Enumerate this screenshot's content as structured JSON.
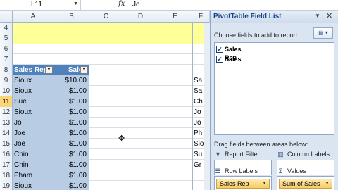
{
  "formula_bar": {
    "name_box": "L11",
    "fx": "fx",
    "value": "Jo"
  },
  "columns": [
    "A",
    "B",
    "C",
    "D",
    "E",
    "F"
  ],
  "rows": [
    {
      "num": "4",
      "type": "yellow",
      "a": "",
      "b": "",
      "f": ""
    },
    {
      "num": "5",
      "type": "yellow",
      "a": "",
      "b": "",
      "f": ""
    },
    {
      "num": "6",
      "type": "plain",
      "a": "",
      "b": "",
      "f": ""
    },
    {
      "num": "7",
      "type": "plain",
      "a": "",
      "b": "",
      "f": ""
    },
    {
      "num": "8",
      "type": "hdr",
      "a": "Sales Rep",
      "b": "Sales",
      "f": ""
    },
    {
      "num": "9",
      "type": "blue",
      "a": "Sioux",
      "b": "$10.00",
      "f": "Sa"
    },
    {
      "num": "10",
      "type": "blue",
      "a": "Sioux",
      "b": "$1.00",
      "f": "Sa"
    },
    {
      "num": "11",
      "type": "blue",
      "a": "Sue",
      "b": "$1.00",
      "f": "Ch"
    },
    {
      "num": "12",
      "type": "blue",
      "a": "Sioux",
      "b": "$1.00",
      "f": "Jo"
    },
    {
      "num": "13",
      "type": "blue",
      "a": "Jo",
      "b": "$1.00",
      "f": "Jo"
    },
    {
      "num": "14",
      "type": "blue",
      "a": "Joe",
      "b": "$1.00",
      "f": "Ph"
    },
    {
      "num": "15",
      "type": "blue",
      "a": "Joe",
      "b": "$1.00",
      "f": "Sio"
    },
    {
      "num": "16",
      "type": "blue",
      "a": "Chin",
      "b": "$1.00",
      "f": "Su"
    },
    {
      "num": "17",
      "type": "blue",
      "a": "Chin",
      "b": "$1.00",
      "f": "Gr"
    },
    {
      "num": "18",
      "type": "blue",
      "a": "Pham",
      "b": "$1.00",
      "f": ""
    },
    {
      "num": "19",
      "type": "blue",
      "a": "Sioux",
      "b": "$1.00",
      "f": ""
    }
  ],
  "selected_row": "11",
  "panel": {
    "title": "PivotTable Field List",
    "choose_label": "Choose fields to add to report:",
    "fields": [
      {
        "label": "Sales Rep",
        "checked": true
      },
      {
        "label": "Sales",
        "checked": true
      }
    ],
    "drag_label": "Drag fields between areas below:",
    "areas": {
      "report_filter": "Report Filter",
      "column_labels": "Column Labels",
      "row_labels": "Row Labels",
      "values": "Values"
    },
    "row_pill": "Sales Rep",
    "values_pill": "Sum of Sales"
  },
  "colors": {
    "header_fill": "#4f81bd",
    "band_fill": "#b8cce4",
    "highlight_fill": "#ffff99",
    "selected_row_header": "#f9d57a"
  }
}
